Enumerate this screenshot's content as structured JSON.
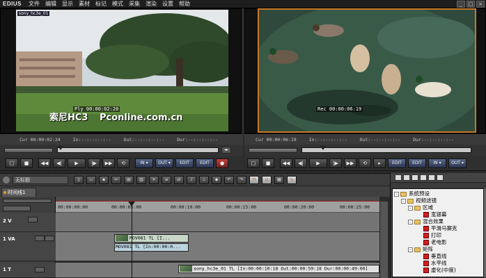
{
  "app": {
    "logo": "EDIUS",
    "menu": [
      "文件",
      "编辑",
      "显示",
      "素材",
      "标记",
      "模式",
      "采集",
      "渲染",
      "设置",
      "帮助"
    ],
    "window_buttons": [
      "_",
      "□",
      "×"
    ]
  },
  "player": {
    "clip_label": "sony_hc3e_01",
    "overlay_timecode": "Ply 00:00:02:20",
    "watermark_brand": "索尼HC3",
    "watermark_site": "Pconline.com.cn",
    "cur": "Cur 00:00:02:24",
    "in": "In:--:--:--:--",
    "out": "Out:--:--:--:--",
    "dur": "Dur:--:--:--:--"
  },
  "recorder": {
    "overlay_timecode": "Rec 00:00:06:19",
    "cur": "Cur 00:00:06:19",
    "in": "In:--:--:--:--",
    "out": "Out:--:--:--:--",
    "dur": "Dur:--:--:--:--"
  },
  "transport": {
    "player_buttons": [
      "□",
      "■",
      "◀◀",
      "◀|",
      "▶",
      "|▶",
      "▶▶",
      "⟲",
      "IN ▾",
      "OUT ▾",
      "EDIT",
      "EDIT",
      "●"
    ],
    "recorder_buttons": [
      "□",
      "■",
      "◀◀",
      "◀|",
      "▶",
      "|▶",
      "▶▶",
      "⟲",
      "▸",
      "EDIT",
      "EDIT",
      "IN ▾",
      "OUT ▾"
    ]
  },
  "timeline": {
    "project_name": "无标题",
    "tab": "时间线1",
    "ruler_labels": [
      "00:00:00:00",
      "00:00:05:00",
      "00:00:10:00",
      "00:00:15:00",
      "00:00:20:00",
      "00:00:25:00"
    ],
    "tracks": [
      {
        "name": "2 V"
      },
      {
        "name": "1 VA"
      },
      {
        "name": "1 T"
      }
    ],
    "clips": [
      {
        "track": "1 VA",
        "text": "MOV081  TL [I..."
      },
      {
        "track": "1 VA",
        "text": "MOV081  TL [In:00:00:0..."
      },
      {
        "track": "1 T",
        "text": "sony_hc3e_01  TL [In:00:00:10:18 Out:00:00:59:18 Dur:00:00:49:00]"
      }
    ]
  },
  "effects_tree": [
    {
      "label": "系统预设",
      "level": 0,
      "type": "folder",
      "expanded": true
    },
    {
      "label": "视频滤镜",
      "level": 1,
      "type": "folder",
      "expanded": true
    },
    {
      "label": "区域",
      "level": 2,
      "type": "folder",
      "expanded": true
    },
    {
      "label": "宽银幕",
      "level": 3,
      "type": "effect"
    },
    {
      "label": "混合效果",
      "level": 2,
      "type": "folder",
      "expanded": true
    },
    {
      "label": "平滑马赛克",
      "level": 3,
      "type": "effect"
    },
    {
      "label": "打印",
      "level": 3,
      "type": "effect"
    },
    {
      "label": "老电影",
      "level": 3,
      "type": "effect"
    },
    {
      "label": "矩阵",
      "level": 2,
      "type": "folder",
      "expanded": true
    },
    {
      "label": "垂直线",
      "level": 3,
      "type": "effect"
    },
    {
      "label": "水平线",
      "level": 3,
      "type": "effect"
    },
    {
      "label": "虚化(中度)",
      "level": 3,
      "type": "effect"
    }
  ],
  "colors": {
    "accent_orange": "#c87a2a",
    "edit_blue": "#2a3450",
    "record_red": "#c04040"
  }
}
